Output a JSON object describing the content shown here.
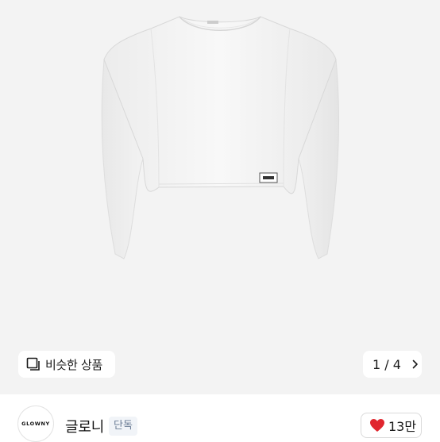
{
  "product": {
    "image_alt": "white long sleeve crop top",
    "shirt_tag_text": "GLOWNY"
  },
  "similar": {
    "icon": "similar-products-icon",
    "label": "비슷한 상품"
  },
  "pager": {
    "label": "1 / 4",
    "icon": "chevron-right-icon"
  },
  "brand": {
    "logo_text": "GLOWNY",
    "name": "글로니",
    "badge": "단독"
  },
  "like": {
    "icon": "heart-icon",
    "count": "13만",
    "heart_color": "#e0262e"
  }
}
